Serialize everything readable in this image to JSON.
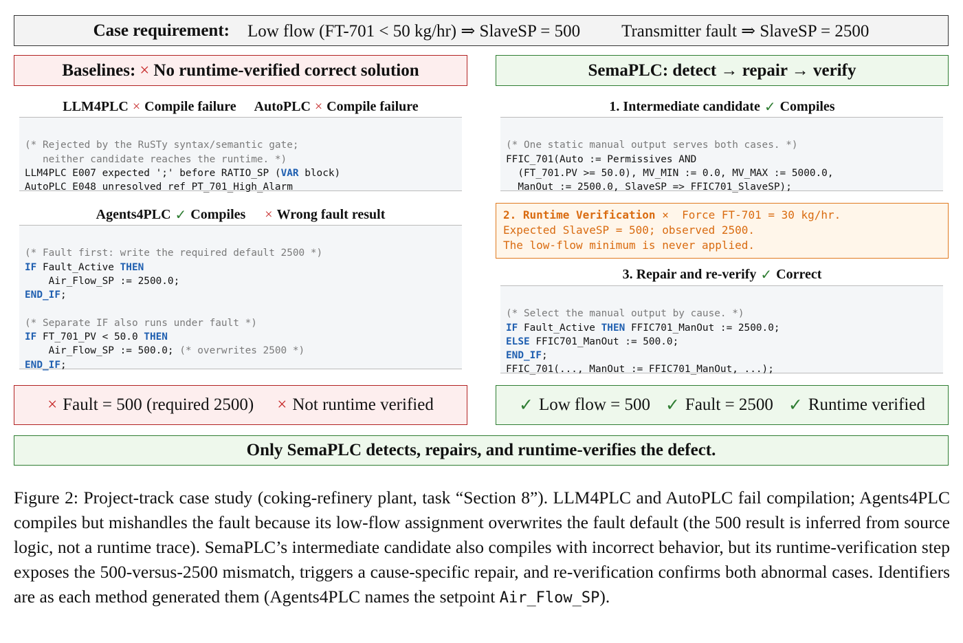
{
  "requirement": {
    "label": "Case requirement:",
    "rule1": "Low flow (FT-701 < 50 kg/hr) ⇒ SlaveSP = 500",
    "rule2": "Transmitter fault ⇒ SlaveSP = 2500"
  },
  "baselines": {
    "header_mark": "×",
    "header": "Baselines:",
    "header_rest": "No runtime-verified correct solution",
    "llm4plc": {
      "name": "LLM4PLC",
      "mark": "×",
      "status": "Compile failure"
    },
    "autoplc": {
      "name": "AutoPLC",
      "mark": "×",
      "status": "Compile failure"
    },
    "compile_code": [
      "(* Rejected by the RuSTy syntax/semantic gate;",
      "   neither candidate reaches the runtime. *)",
      "LLM4PLC E007 expected ';' before RATIO_SP (",
      "VAR",
      " block)",
      "AutoPLC E048 unresolved ref PT_701_High_Alarm"
    ],
    "agents4plc": {
      "name": "Agents4PLC",
      "mark1": "✓",
      "status1": "Compiles",
      "mark2": "×",
      "status2": "Wrong fault result"
    },
    "agents_code": {
      "c1": "(* Fault first: write the required default 2500 *)",
      "l1_kw": "IF",
      "l1_rest": " Fault_Active ",
      "l1_kw2": "THEN",
      "l2": "    Air_Flow_SP := 2500.0;",
      "l3_kw": "END_IF",
      "l3_rest": ";",
      "c2": "(* Separate IF also runs under fault *)",
      "l4_kw": "IF",
      "l4_rest": " FT_701_PV < 50.0 ",
      "l4_kw2": "THEN",
      "l5": "    Air_Flow_SP := 500.0; ",
      "l5_cm": "(* overwrites 2500 *)",
      "l6_kw": "END_IF",
      "l6_rest": ";"
    },
    "result": {
      "mark1": "×",
      "item1": "Fault = 500 (required 2500)",
      "mark2": "×",
      "item2": "Not runtime verified"
    }
  },
  "semaplc": {
    "header": "SemaPLC: detect → repair → verify",
    "step1": {
      "title": "1. Intermediate candidate",
      "mark": "✓",
      "status": "Compiles"
    },
    "step1_code": [
      "(* One static manual output serves both cases. *)",
      "FFIC_701(Auto := Permissives AND",
      "  (FT_701.PV >= 50.0), MV_MIN := 0.0, MV_MAX := 5000.0,",
      "  ManOut := 2500.0, SlaveSP => FFIC701_SlaveSP);"
    ],
    "step2": {
      "title": "2. Runtime Verification",
      "mark": "×",
      "line1": "Force FT-701 = 30 kg/hr.",
      "line2": "Expected SlaveSP = 500; observed 2500.",
      "line3": "The low-flow minimum is never applied."
    },
    "step3": {
      "title": "3. Repair and re-verify",
      "mark": "✓",
      "status": "Correct"
    },
    "step3_code": {
      "c1": "(* Select the manual output by cause. *)",
      "l1_kw": "IF",
      "l1_rest": " Fault_Active ",
      "l1_kw2": "THEN",
      "l1_tail": " FFIC701_ManOut := 2500.0;",
      "l2_kw": "ELSE",
      "l2_rest": " FFIC701_ManOut := 500.0;",
      "l3_kw": "END_IF",
      "l3_rest": ";",
      "l4": "FFIC_701(..., ManOut := FFIC701_ManOut, ...);"
    },
    "result": {
      "mark1": "✓",
      "item1": "Low flow = 500",
      "mark2": "✓",
      "item2": "Fault = 2500",
      "mark3": "✓",
      "item3": "Runtime verified"
    }
  },
  "bottom_banner": "Only SemaPLC detects, repairs, and runtime-verifies the defect.",
  "caption": {
    "text": "Figure 2: Project-track case study (coking-refinery plant, task “Section 8”). LLM4PLC and AutoPLC fail compilation; Agents4PLC compiles but mishandles the fault because its low-flow assignment overwrites the fault default (the 500 result is inferred from source logic, not a runtime trace). SemaPLC’s intermediate candidate also compiles with incorrect behavior, but its runtime-verification step exposes the 500-versus-2500 mismatch, triggers a cause-specific repair, and re-verification confirms both abnormal cases. Identifiers are as each method generated them (Agents4PLC names the setpoint ",
    "mono": "Air_Flow_SP",
    "end": ")."
  },
  "colors": {
    "fail_red": "#c62828",
    "pass_green": "#2e7d32",
    "warn_orange": "#d96b10",
    "keyword_blue": "#1f5fb0"
  }
}
